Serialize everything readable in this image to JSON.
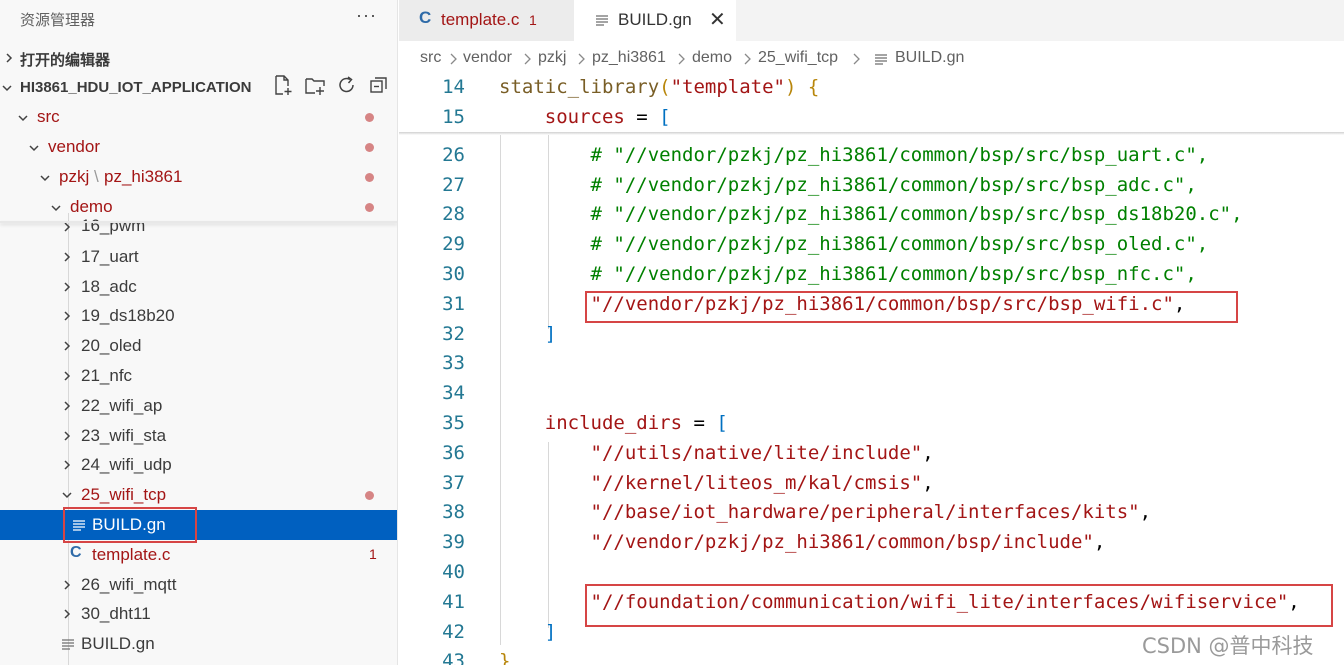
{
  "explorer": {
    "title": "资源管理器",
    "more": "···",
    "open_editors": "打开的编辑器",
    "workspace": "HI3861_HDU_IOT_APPLICATION",
    "tree": {
      "src": "src",
      "vendor": "vendor",
      "pzkj": "pzkj",
      "pzkj_sep": "\\",
      "pz_hi3861": "pz_hi3861",
      "demo": "demo",
      "items": [
        "16_pwm",
        "17_uart",
        "18_adc",
        "19_ds18b20",
        "20_oled",
        "21_nfc",
        "22_wifi_ap",
        "23_wifi_sta",
        "24_wifi_udp"
      ],
      "wifi_tcp": "25_wifi_tcp",
      "build_gn": "BUILD.gn",
      "template_c": "template.c",
      "template_errors": "1",
      "after": [
        "26_wifi_mqtt",
        "30_dht11"
      ],
      "root_build": "BUILD.gn"
    }
  },
  "tabs": [
    {
      "label": "template.c",
      "count": "1",
      "icon": "C"
    },
    {
      "label": "BUILD.gn",
      "close": "✕"
    }
  ],
  "breadcrumb": [
    "src",
    "vendor",
    "pzkj",
    "pz_hi3861",
    "demo",
    "25_wifi_tcp",
    "BUILD.gn"
  ],
  "code": {
    "line_numbers": [
      "14",
      "15",
      "26",
      "27",
      "28",
      "29",
      "30",
      "31",
      "32",
      "33",
      "34",
      "35",
      "36",
      "37",
      "38",
      "39",
      "40",
      "41",
      "42",
      "43"
    ],
    "l14_fn": "static_library",
    "l14_arg": "\"template\"",
    "l15_var": "sources",
    "l26": "# \"//vendor/pzkj/pz_hi3861/common/bsp/src/bsp_uart.c\",",
    "l27": "# \"//vendor/pzkj/pz_hi3861/common/bsp/src/bsp_adc.c\",",
    "l28": "# \"//vendor/pzkj/pz_hi3861/common/bsp/src/bsp_ds18b20.c\",",
    "l29": "# \"//vendor/pzkj/pz_hi3861/common/bsp/src/bsp_oled.c\",",
    "l30": "# \"//vendor/pzkj/pz_hi3861/common/bsp/src/bsp_nfc.c\",",
    "l31": "\"//vendor/pzkj/pz_hi3861/common/bsp/src/bsp_wifi.c\"",
    "l35_var": "include_dirs",
    "l36": "\"//utils/native/lite/include\"",
    "l37": "\"//kernel/liteos_m/kal/cmsis\"",
    "l38": "\"//base/iot_hardware/peripheral/interfaces/kits\"",
    "l39": "\"//vendor/pzkj/pz_hi3861/common/bsp/include\"",
    "l41": "\"//foundation/communication/wifi_lite/interfaces/wifiservice\""
  },
  "watermark": "CSDN @普中科技",
  "colors": {
    "accent_selection": "#0060c0",
    "highlight_box": "#d64545",
    "modified": "#a31515"
  }
}
